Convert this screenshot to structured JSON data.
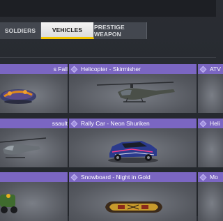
{
  "tabs": [
    {
      "label": "SOLDIERS",
      "active": false
    },
    {
      "label": "VEHICLES",
      "active": true
    },
    {
      "label": "PRESTIGE WEAPON",
      "active": false
    }
  ],
  "accent_color": "#f2c500",
  "card_header_color": "#7b66c2",
  "cards": [
    {
      "label": "s Fall",
      "icon": "boat-icon"
    },
    {
      "label": "Helicopter - Skirmisher",
      "icon": "helicopter-icon"
    },
    {
      "label": "ATV",
      "icon": "atv-icon"
    },
    {
      "label": "ssault",
      "icon": "helicopter-icon"
    },
    {
      "label": "Rally Car - Neon Shuriken",
      "icon": "car-icon"
    },
    {
      "label": "Heli",
      "icon": "helicopter-icon"
    },
    {
      "label": "",
      "icon": "vehicle-icon"
    },
    {
      "label": "Snowboard - Night in Gold",
      "icon": "snowboard-icon"
    },
    {
      "label": "Mo",
      "icon": "vehicle-icon"
    }
  ]
}
